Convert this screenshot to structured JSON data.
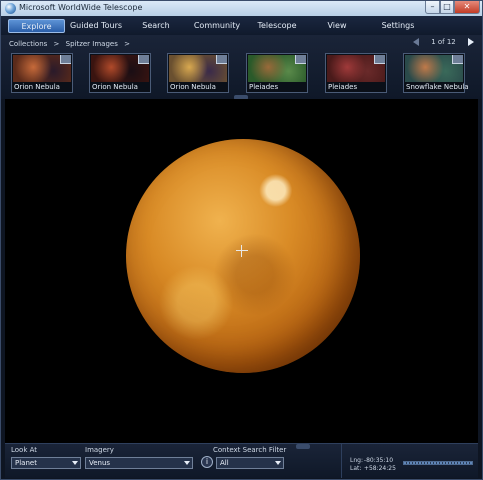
{
  "window": {
    "title": "Microsoft WorldWide Telescope"
  },
  "menu": {
    "tabs": [
      {
        "label": "Explore",
        "active": true
      },
      {
        "label": "Guided Tours",
        "active": false
      },
      {
        "label": "Search",
        "active": false
      },
      {
        "label": "Community",
        "active": false
      },
      {
        "label": "Telescope",
        "active": false
      },
      {
        "label": "View",
        "active": false
      },
      {
        "label": "Settings",
        "active": false
      }
    ]
  },
  "browse": {
    "breadcrumb": [
      "Collections",
      ">",
      "Spitzer Images",
      ">"
    ],
    "pager": {
      "text": "1 of 12"
    },
    "thumbnails": [
      {
        "label": "Orion Nebula",
        "colors": [
          "#5a2a1a",
          "#c66a3a",
          "#2a1a2a"
        ]
      },
      {
        "label": "Orion Nebula",
        "colors": [
          "#3a1410",
          "#b04a2a",
          "#1a0e14"
        ]
      },
      {
        "label": "Orion Nebula",
        "colors": [
          "#6a5030",
          "#d8a850",
          "#3a2a4a"
        ]
      },
      {
        "label": "Pleiades",
        "colors": [
          "#2a5a2a",
          "#9a6a3a",
          "#5a8a4a"
        ]
      },
      {
        "label": "Pleiades",
        "colors": [
          "#4a1a1a",
          "#a03a3a",
          "#6a2a2a"
        ]
      },
      {
        "label": "Snowflake Nebula",
        "colors": [
          "#2a4a4a",
          "#c07a4a",
          "#3a6a5a"
        ]
      }
    ]
  },
  "viewport": {
    "object": "Venus"
  },
  "bottom": {
    "look_at": {
      "label": "Look At",
      "value": "Planet"
    },
    "imagery": {
      "label": "Imagery",
      "value": "Venus"
    },
    "context": {
      "label": "Context Search Filter",
      "value": "All"
    },
    "info_symbol": "i",
    "coords": {
      "lng_key": "Lng:",
      "lng": "-80:35:10",
      "lat_key": "Lat:",
      "lat": "+58:24:25"
    }
  },
  "colors": {
    "accent": "#3b74c3",
    "planet": "#d98b26",
    "background": "#000000"
  }
}
